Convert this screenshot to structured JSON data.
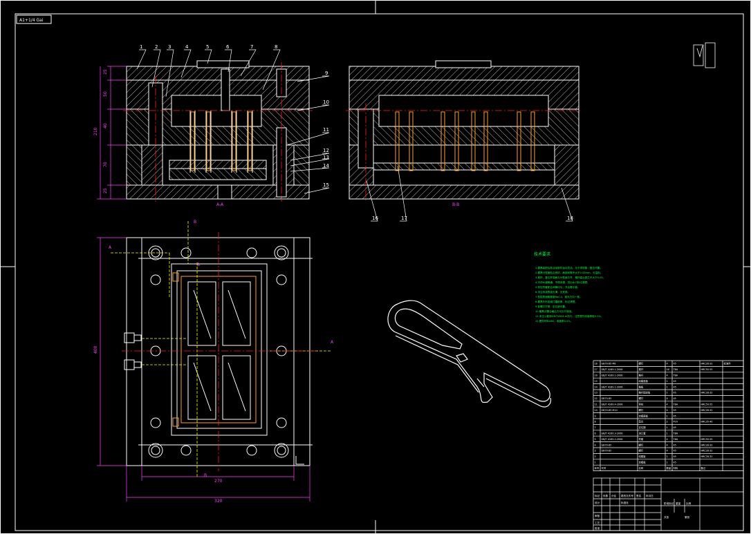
{
  "sheet": {
    "file_tag": "A1+1/4 Gai"
  },
  "callouts": [
    "1",
    "2",
    "3",
    "4",
    "5",
    "6",
    "7",
    "8",
    "9",
    "10",
    "11",
    "12",
    "13",
    "14",
    "15",
    "16",
    "17",
    "18"
  ],
  "section_labels": {
    "aa": "A-A",
    "bb": "B-B",
    "mark_a": "A",
    "mark_b": "B"
  },
  "dimensions": {
    "left_stack": [
      "25",
      "50",
      "40",
      "70",
      "25"
    ],
    "left_total": "210",
    "plan_height": "400",
    "plan_width_inner": "270",
    "plan_width_outer": "320"
  },
  "tech_notes": {
    "heading": "技术要求",
    "lines": [
      "1.模具装配后各活动部件运动灵活，无卡滞现象，复位可靠。",
      "2.模具分型面贴合良好，局部间隙不大于0.03mm，无溢料。",
      "3.推杆、复位杆端面与分型面平齐，推杆高出型芯不大于0.05。",
      "4.冷却水道畅通，不得渗漏，进出水口标记清楚。",
      "5.导柱导套配合间隙均匀，开合模平稳。",
      "6.浇注系统表面光滑，无死角。",
      "7.型腔表面粗糙度Ra0.4，抛光方向一致。",
      "8.模具外形各面打磨倒角，标记清楚。",
      "9.各螺钉拧紧，定位销可靠。",
      "10.模具试模合格后方可交付使用。",
      "11.未注公差按GB/T1804-m执行，注意塑件收缩率取0.5%。",
      "12.塑件材料ABS，收缩率0.5%。"
    ]
  },
  "bom": {
    "rows": [
      [
        "18",
        "GB70-85 M6",
        "螺钉",
        "4",
        "45",
        "HRC28-32",
        "标准件"
      ],
      [
        "17",
        "GB/T 4169.1-2006",
        "推杆",
        "16",
        "T8A",
        "HRC50-55",
        ""
      ],
      [
        "16",
        "GB/T 4169.1-2006",
        "推杆",
        "4",
        "T8A",
        "",
        ""
      ],
      [
        "15",
        "",
        "动模座板",
        "1",
        "45",
        "",
        ""
      ],
      [
        "14",
        "GB/T 4169.1-2006",
        "推板",
        "1",
        "45",
        "",
        ""
      ],
      [
        "13",
        "",
        "推杆固定板",
        "1",
        "45",
        "HRC28-32",
        ""
      ],
      [
        "12",
        "GB70-85",
        "螺钉",
        "4",
        "45",
        "",
        ""
      ],
      [
        "11",
        "GB/T 4169.4-2006",
        "导柱",
        "4",
        "T8A",
        "HRC50-55",
        ""
      ],
      [
        "10",
        "GB70-85 M10",
        "螺钉",
        "4",
        "45",
        "HRC28-32",
        ""
      ],
      [
        "9",
        "",
        "定模座板",
        "1",
        "45",
        "",
        ""
      ],
      [
        "8",
        "",
        "型芯",
        "2",
        "P20",
        "HRC35-40",
        ""
      ],
      [
        "7",
        "",
        "定位圈",
        "1",
        "45",
        "",
        ""
      ],
      [
        "6",
        "GB/T 4169.3-2006",
        "浇口套",
        "1",
        "T8A",
        "",
        ""
      ],
      [
        "5",
        "GB/T 4169.2-2006",
        "导套",
        "4",
        "T8A",
        "HRC50-55",
        ""
      ],
      [
        "4",
        "GB70-85",
        "螺钉",
        "4",
        "45",
        "HRC28-32",
        ""
      ],
      [
        "3",
        "GB70-85",
        "螺钉",
        "4",
        "45",
        "HRC28-32",
        ""
      ],
      [
        "2",
        "",
        "动模板",
        "1",
        "45",
        "HRC28-32",
        ""
      ],
      [
        "1",
        "",
        "定模板",
        "1",
        "45",
        "",
        ""
      ]
    ],
    "header": [
      "序号",
      "代号",
      "名称",
      "数量",
      "材料",
      "备注",
      ""
    ]
  },
  "title_block": {
    "cells": [
      "标记",
      "处数",
      "分区",
      "更改文件号",
      "签名",
      "年月日",
      "设计",
      "标准化",
      "阶段标记",
      "重量",
      "比例",
      "审核",
      "工艺",
      "批准",
      "共张",
      "第张"
    ]
  },
  "colors": {
    "white": "#ffffff",
    "red": "#ff2020",
    "green": "#00ff44",
    "magenta": "#ff40ff",
    "yellow": "#ffff00",
    "orange": "#ffa020",
    "cyan": "#40ffff"
  }
}
